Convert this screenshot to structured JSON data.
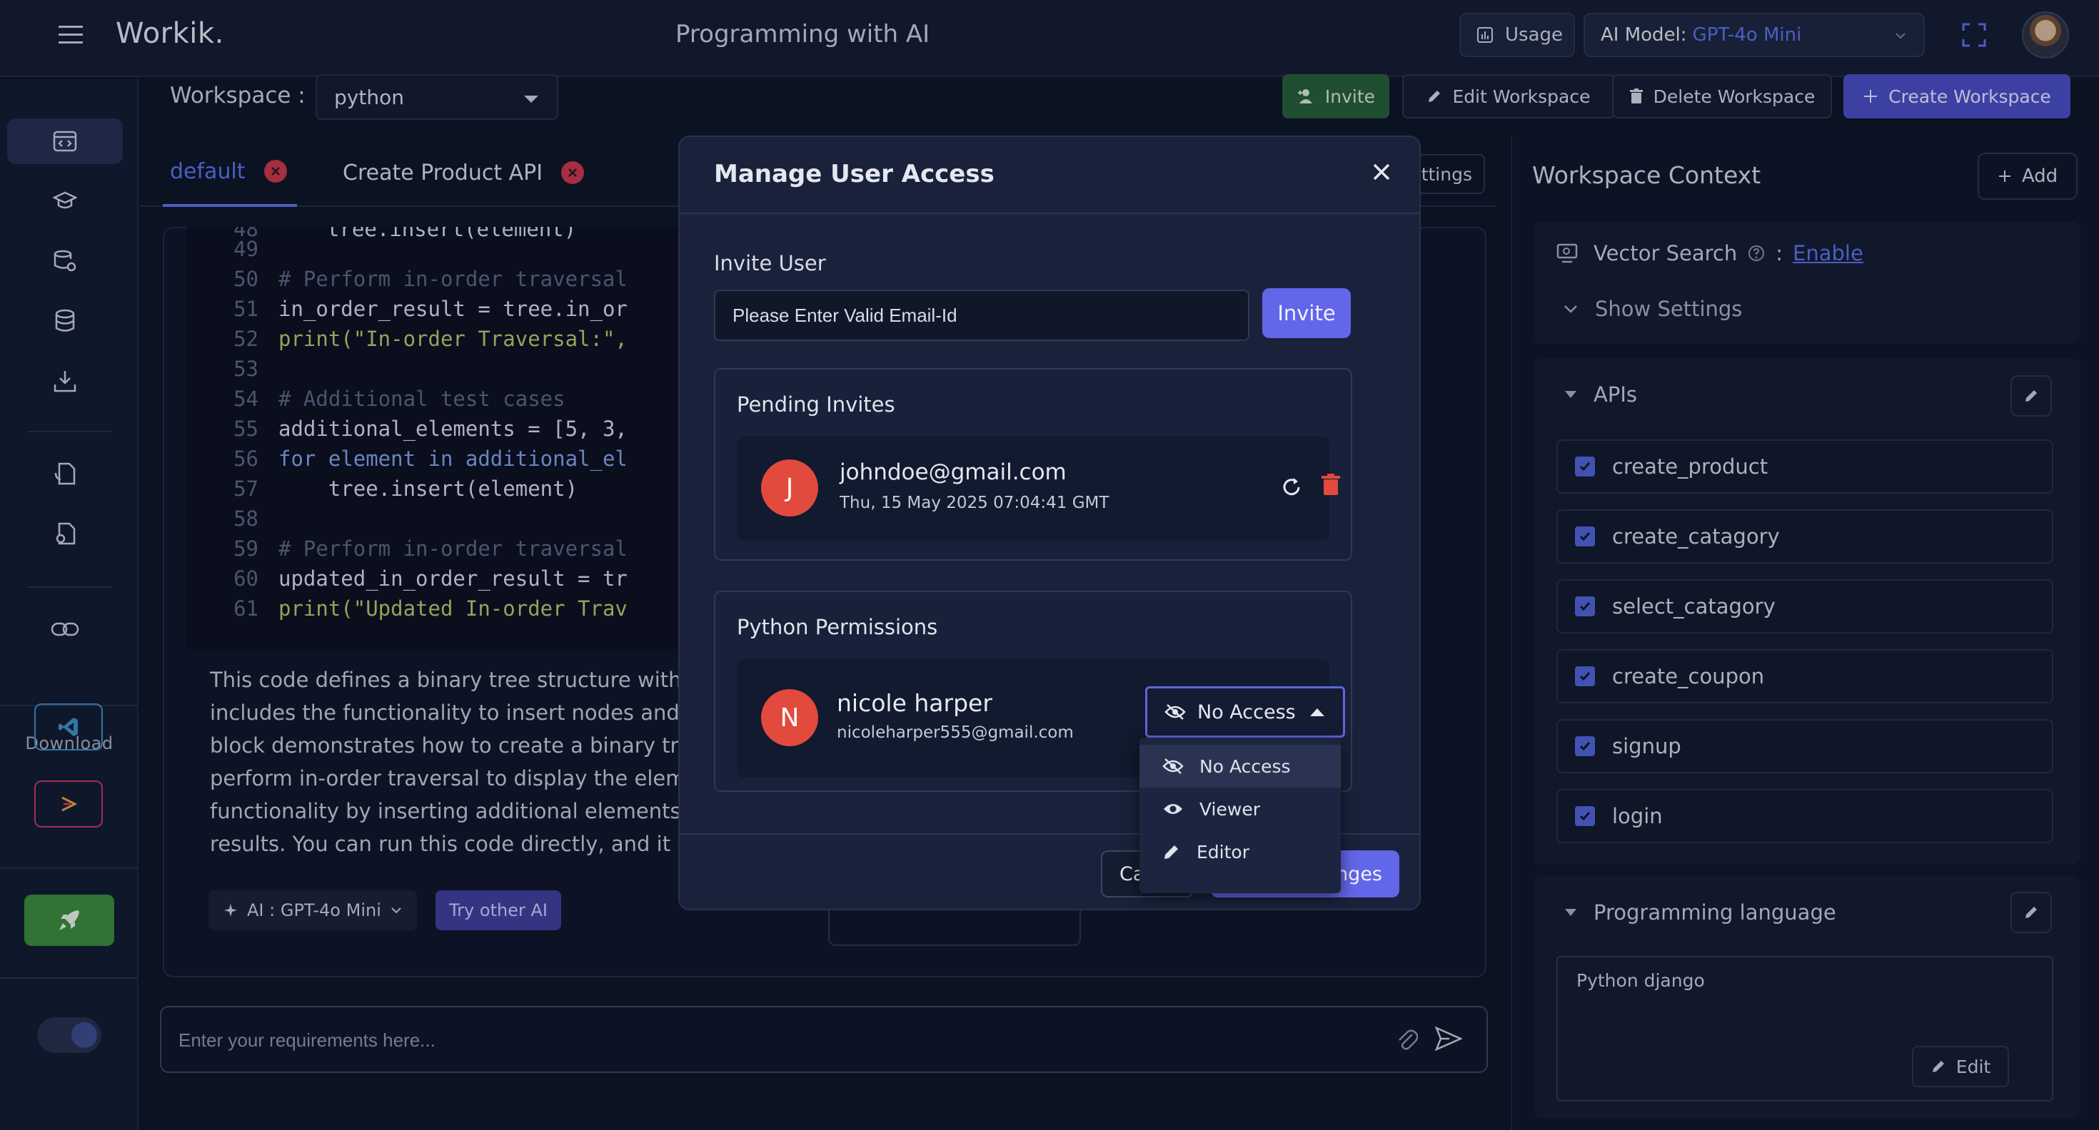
{
  "app": {
    "logo": "Workik.",
    "title": "Programming with AI"
  },
  "header": {
    "usage_label": "Usage",
    "ai_model_label": "AI Model:",
    "ai_model_value": "GPT-4o Mini"
  },
  "sidebar": {
    "download_label": "Download"
  },
  "workspace": {
    "label": "Workspace :",
    "selected": "python",
    "invite_label": "Invite",
    "edit_label": "Edit Workspace",
    "delete_label": "Delete Workspace",
    "create_label": "Create Workspace"
  },
  "tabs": [
    {
      "label": "default"
    },
    {
      "label": "Create Product API"
    }
  ],
  "settings_fragment": "ttings",
  "code": [
    {
      "n": "48",
      "text": "tree.insert(element)"
    },
    {
      "n": "49",
      "text": ""
    },
    {
      "n": "50",
      "text": "# Perform in-order traversal"
    },
    {
      "n": "51",
      "text": "in_order_result = tree.in_or"
    },
    {
      "n": "52",
      "text": "print(\"In-order Traversal:\","
    },
    {
      "n": "53",
      "text": ""
    },
    {
      "n": "54",
      "text": "# Additional test cases"
    },
    {
      "n": "55",
      "text": "additional_elements = [5, 3,"
    },
    {
      "n": "56",
      "text": "for element in additional_el"
    },
    {
      "n": "57",
      "text": "    tree.insert(element)"
    },
    {
      "n": "58",
      "text": ""
    },
    {
      "n": "59",
      "text": "# Perform in-order traversal"
    },
    {
      "n": "60",
      "text": "updated_in_order_result = tr"
    },
    {
      "n": "61",
      "text": "print(\"Updated In-order Trav"
    }
  ],
  "ai_response": [
    "This code defines a binary tree structure with cl",
    "includes the functionality to insert nodes and tr",
    "block demonstrates how to create a binary tree",
    "perform in-order traversal to display the eleme",
    "functionality by inserting additional elements a",
    "results. You can run this code directly, and it wil"
  ],
  "ai_chip": {
    "label": "AI : GPT-4o Mini"
  },
  "try_other_ai": "Try other AI",
  "context_fragment": "context",
  "chat_input": {
    "placeholder": "Enter your requirements here..."
  },
  "right_panel": {
    "title": "Workspace Context",
    "add_label": "Add",
    "vector_search_label": "Vector Search",
    "vector_search_sep": ":",
    "enable_link": "Enable",
    "show_settings": "Show Settings",
    "apis_title": "APIs",
    "apis": [
      "create_product",
      "create_catagory",
      "select_catagory",
      "create_coupon",
      "signup",
      "login"
    ],
    "programming_language_title": "Programming language",
    "programming_language_value": "Python django",
    "edit_label": "Edit"
  },
  "modal": {
    "title": "Manage User Access",
    "invite_user_label": "Invite User",
    "invite_placeholder": "Please Enter Valid Email-Id",
    "invite_button": "Invite",
    "pending_title": "Pending Invites",
    "pending": {
      "initial": "J",
      "email": "johndoe@gmail.com",
      "date": "Thu, 15 May 2025 07:04:41 GMT"
    },
    "permissions_title": "Python Permissions",
    "user": {
      "initial": "N",
      "name": "nicole harper",
      "email": "nicoleharper555@gmail.com",
      "access": "No Access"
    },
    "cancel_fragment": "Ca",
    "save_fragment": "nges"
  },
  "access_options": [
    "No Access",
    "Viewer",
    "Editor"
  ],
  "colors": {
    "accent": "#6266e8",
    "link": "#5b72e8",
    "danger": "#e14a3d",
    "success": "#255e37"
  }
}
